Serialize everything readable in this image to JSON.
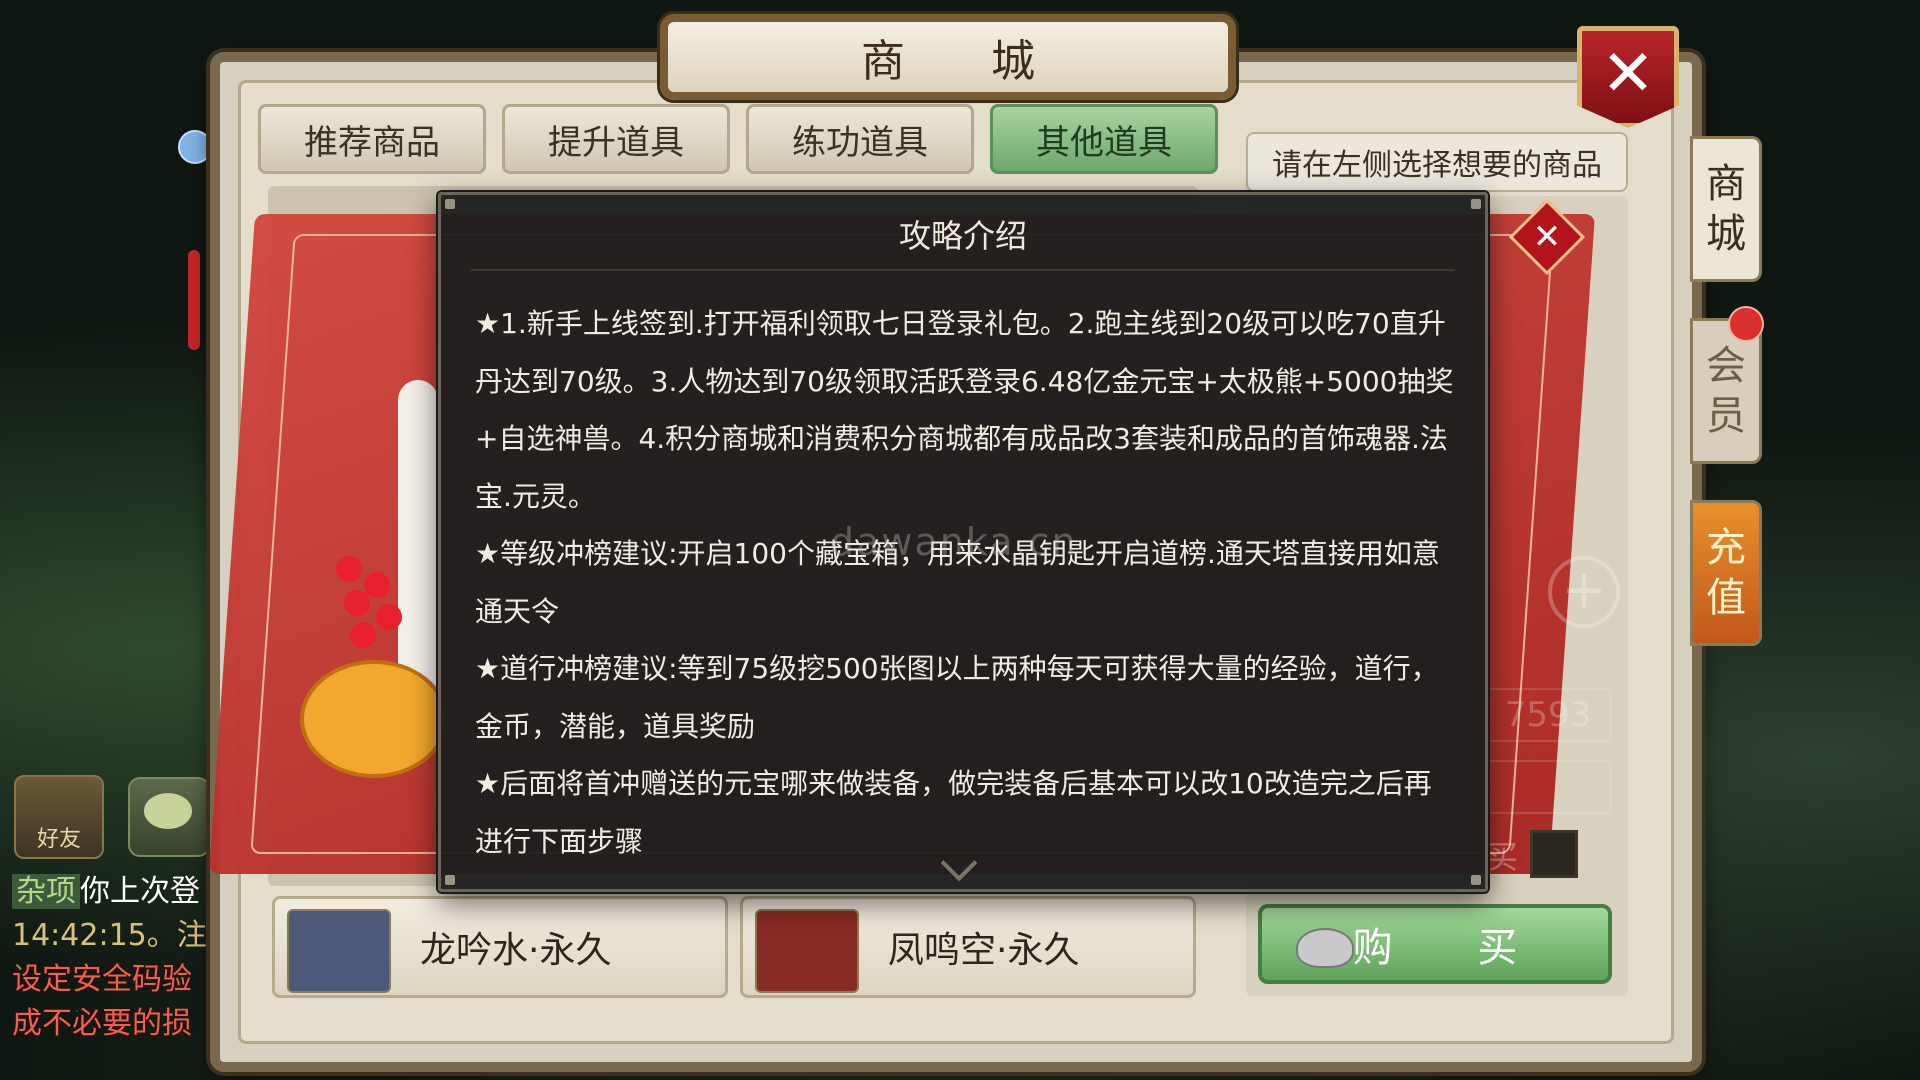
{
  "window": {
    "title": "商 城",
    "close_icon": "close-icon"
  },
  "tabs": [
    {
      "label": "推荐商品",
      "active": false
    },
    {
      "label": "提升道具",
      "active": false
    },
    {
      "label": "练功道具",
      "active": false
    },
    {
      "label": "其他道具",
      "active": true
    }
  ],
  "right_panel": {
    "hint": "请在左侧选择想要的商品",
    "partial_number": "7593",
    "buy_checkbox_label_fragment": "买",
    "buy_button": "购 买"
  },
  "side_tabs": [
    "商城",
    "会员",
    "充值"
  ],
  "items": [
    {
      "name": "龙吟水·永久"
    },
    {
      "name": "凤鸣空·永久"
    }
  ],
  "hud": {
    "friend_label": "好友",
    "chat_lines": [
      {
        "tag": "杂项",
        "text": "你上次登"
      },
      {
        "text": "14:42:15。注"
      },
      {
        "text": "设定安全码验"
      },
      {
        "text": "成不必要的损"
      }
    ]
  },
  "watermark": "dawanka.cn",
  "modal": {
    "title": "攻略介绍",
    "paragraphs": [
      "★1.新手上线签到.打开福利领取七日登录礼包。2.跑主线到20级可以吃70直升丹达到70级。3.人物达到70级领取活跃登录6.48亿金元宝+太极熊+5000抽奖+自选神兽。4.积分商城和消费积分商城都有成品改3套装和成品的首饰魂器.法宝.元灵。",
      "★等级冲榜建议:开启100个藏宝箱，用来水晶钥匙开启道榜.通天塔直接用如意通天令",
      "★道行冲榜建议:等到75级挖500张图以上两种每天可获得大量的经验，道行，金币，潜能，道具奖励",
      "★后面将首冲赠送的元宝哪来做装备，做完装备后基本可以改10改造完之后再进行下面步骤"
    ]
  }
}
